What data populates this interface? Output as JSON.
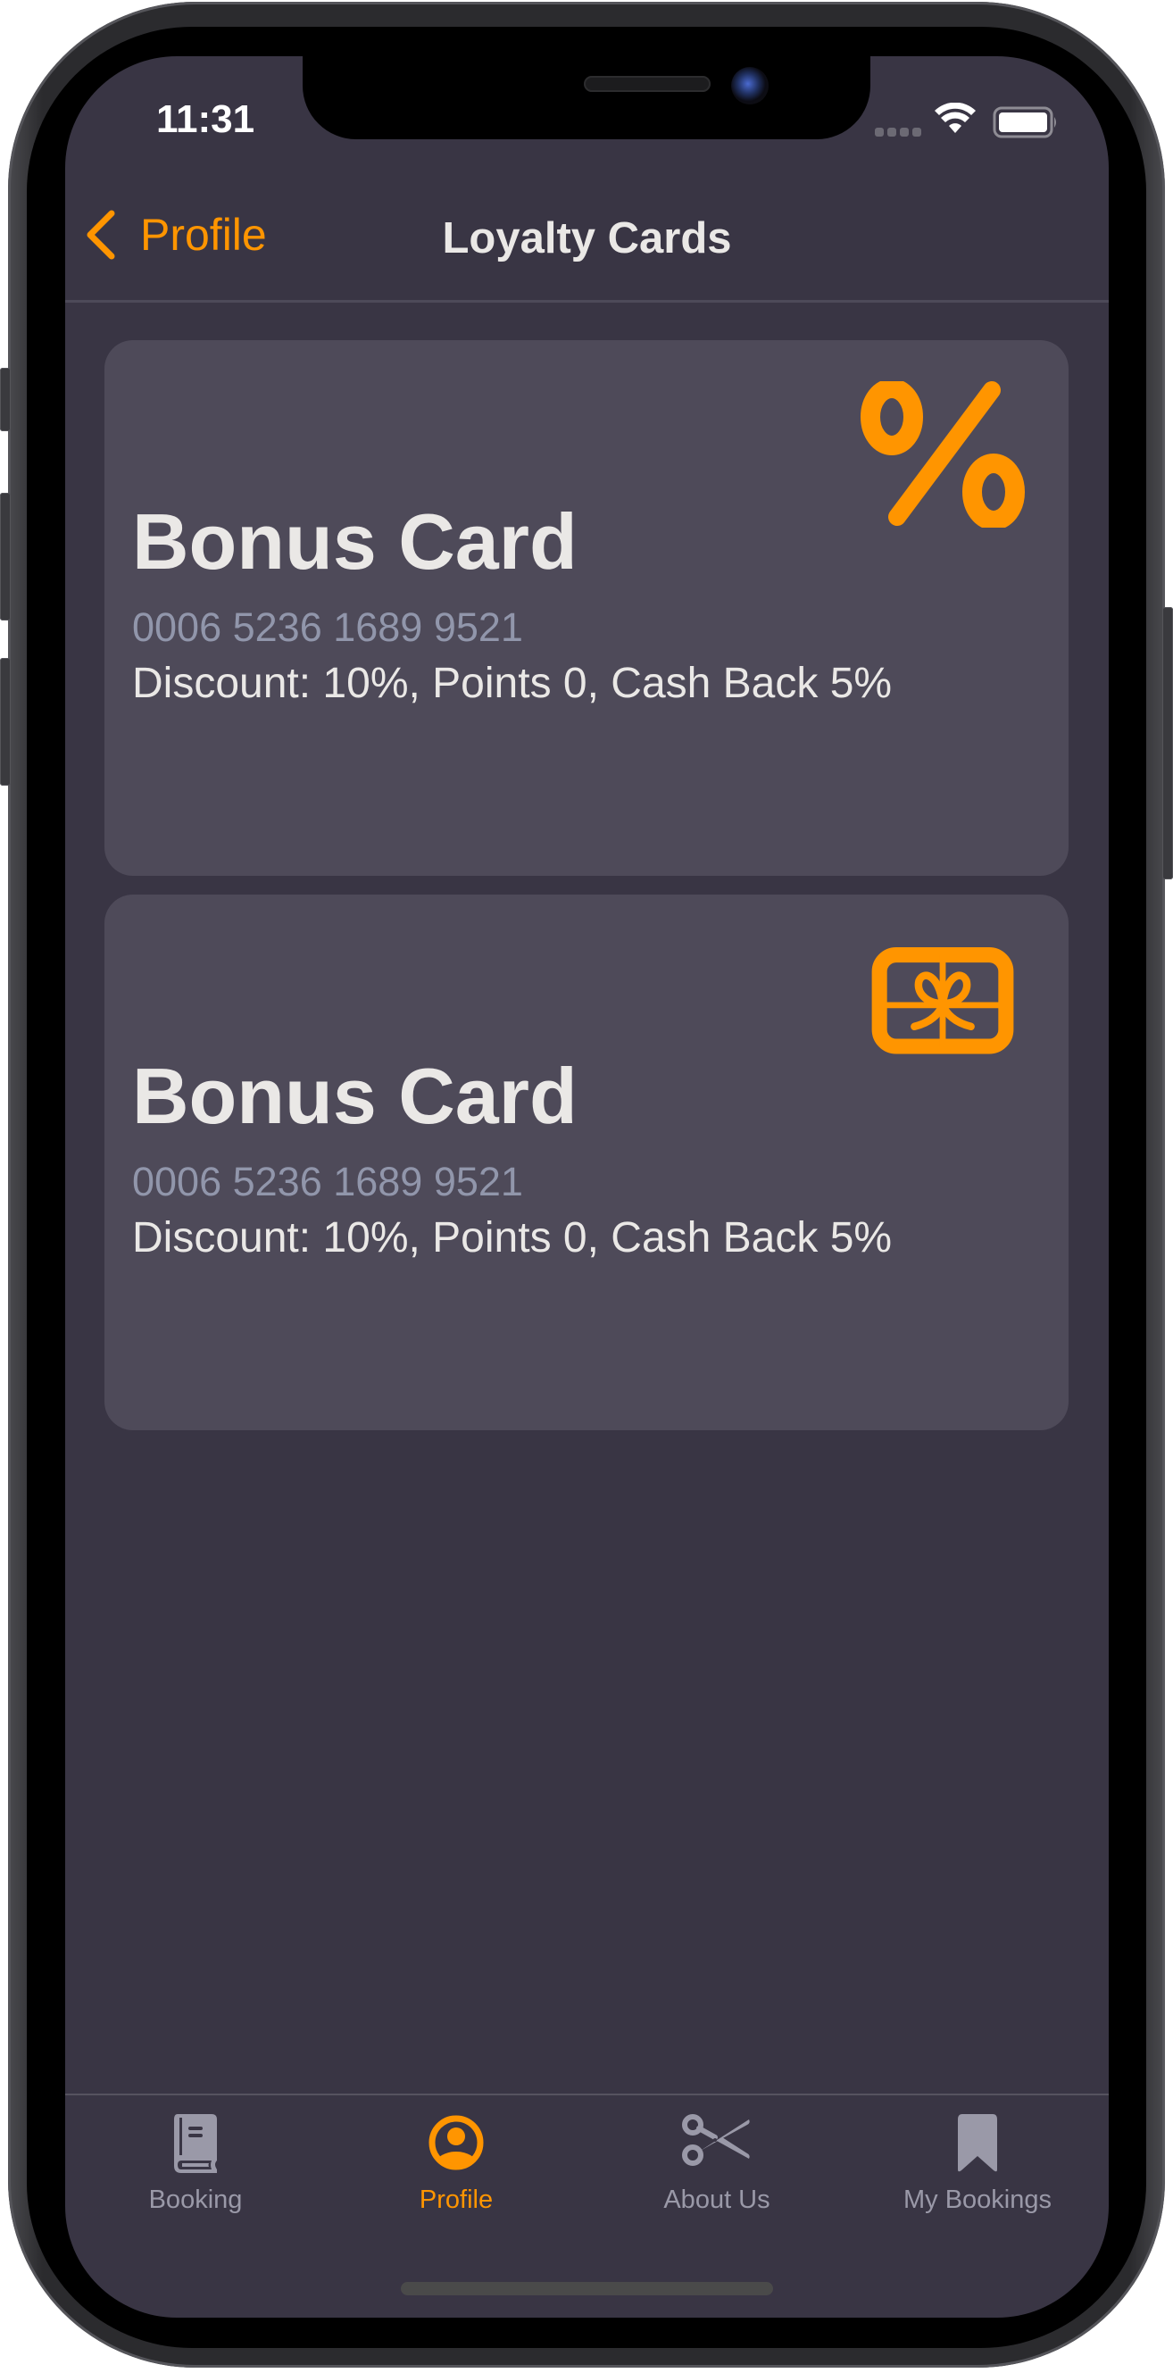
{
  "status_bar": {
    "time": "11:31",
    "signal_icon": "cellular-signal-icon",
    "wifi_icon": "wifi-icon",
    "battery_icon": "battery-full-icon"
  },
  "nav": {
    "back_label": "Profile",
    "back_icon": "chevron-left-icon",
    "title": "Loyalty Cards"
  },
  "cards": [
    {
      "title": "Bonus Card",
      "number": "0006 5236 1689 9521",
      "details": "Discount: 10%, Points 0, Cash Back 5%",
      "icon": "percent-icon"
    },
    {
      "title": "Bonus Card",
      "number": "0006 5236 1689 9521",
      "details": "Discount: 10%, Points 0, Cash Back 5%",
      "icon": "gift-card-icon"
    }
  ],
  "tabs": [
    {
      "label": "Booking",
      "icon": "book-icon",
      "active": false
    },
    {
      "label": "Profile",
      "icon": "person-circle-icon",
      "active": true
    },
    {
      "label": "About Us",
      "icon": "scissors-icon",
      "active": false
    },
    {
      "label": "My Bookings",
      "icon": "bookmark-icon",
      "active": false
    }
  ],
  "colors": {
    "accent": "#FF9500",
    "background": "#393544",
    "card_background": "#4E4A59",
    "primary_text": "#EAE8E6",
    "secondary_text": "#9196AB",
    "tab_inactive": "#9A99A8"
  }
}
